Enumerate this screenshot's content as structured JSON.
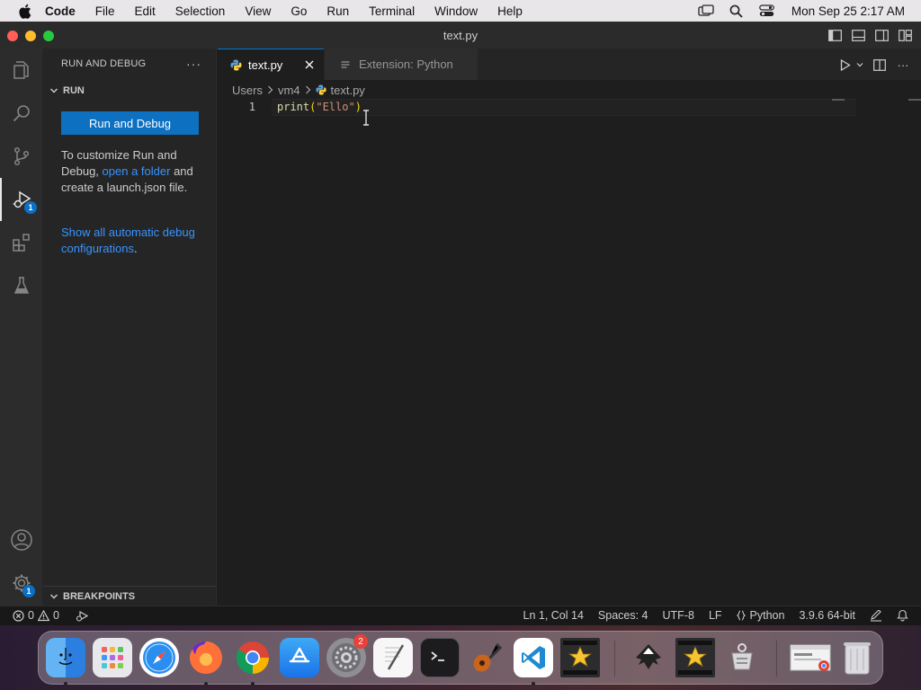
{
  "menubar": {
    "app_name": "Code",
    "items": [
      "File",
      "Edit",
      "Selection",
      "View",
      "Go",
      "Run",
      "Terminal",
      "Window",
      "Help"
    ],
    "clock": "Mon Sep 25  2:17 AM"
  },
  "window": {
    "title": "text.py"
  },
  "activitybar": {
    "run_debug_badge": "1",
    "manage_badge": "1"
  },
  "sidebar": {
    "title": "RUN AND DEBUG",
    "section_run": "RUN",
    "run_button": "Run and Debug",
    "customize_text_1": "To customize Run and Debug,",
    "open_folder_link": "open a folder",
    "customize_text_2": "and create a launch.json file.",
    "show_configs_link": "Show all automatic debug configurations",
    "show_configs_suffix": ".",
    "section_breakpoints": "BREAKPOINTS"
  },
  "tabs": [
    {
      "label": "text.py",
      "active": true
    },
    {
      "label": "Extension: Python",
      "active": false
    }
  ],
  "breadcrumb": [
    "Users",
    "vm4",
    "text.py"
  ],
  "editor": {
    "line_number": "1",
    "code_fn": "print",
    "code_open": "(",
    "code_string": "\"Ello\"",
    "code_close": ")"
  },
  "statusbar": {
    "errors": "0",
    "warnings": "0",
    "position": "Ln 1, Col 14",
    "spaces": "Spaces: 4",
    "encoding": "UTF-8",
    "eol": "LF",
    "language": "Python",
    "interpreter": "3.9.6 64-bit"
  },
  "dock": {
    "settings_badge": "2"
  },
  "colors": {
    "accent": "#0e70c0",
    "link": "#3794ff",
    "badge": "#0a70c6"
  }
}
